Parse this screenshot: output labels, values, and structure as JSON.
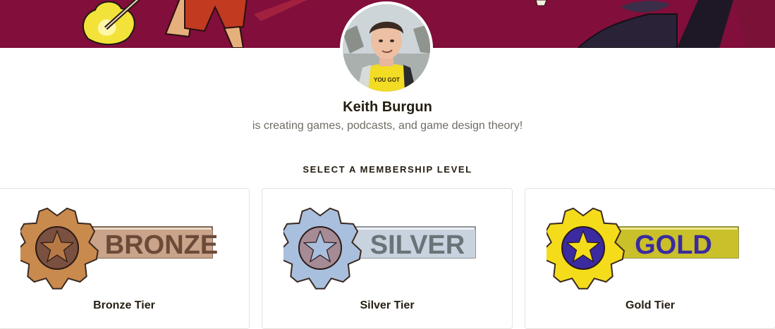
{
  "creator": {
    "name": "Keith Burgun",
    "tagline": "is creating games, podcasts, and game design theory!",
    "avatar_shirt_text": "YOU GOT"
  },
  "membership": {
    "heading": "SELECT A MEMBERSHIP LEVEL",
    "tiers": [
      {
        "badge_text": "BRONZE",
        "name": "Bronze Tier",
        "gear_color": "#c98a4e",
        "bar_color": "#c9a38a",
        "text_color": "#6b4a38",
        "star_color": "#b77a47",
        "hub_color": "#7a5040"
      },
      {
        "badge_text": "SILVER",
        "name": "Silver Tier",
        "gear_color": "#a9bfde",
        "bar_color": "#c9d3df",
        "text_color": "#6a7378",
        "star_color": "#a9bfde",
        "hub_color": "#a58b96"
      },
      {
        "badge_text": "GOLD",
        "name": "Gold Tier",
        "gear_color": "#f5dc1a",
        "bar_color": "#c9c02a",
        "text_color": "#3b2aa0",
        "star_color": "#f5dc1a",
        "hub_color": "#3b2aa0"
      }
    ]
  },
  "colors": {
    "banner": "#8c1040",
    "page_text": "#241e12",
    "muted_text": "#706c64"
  }
}
